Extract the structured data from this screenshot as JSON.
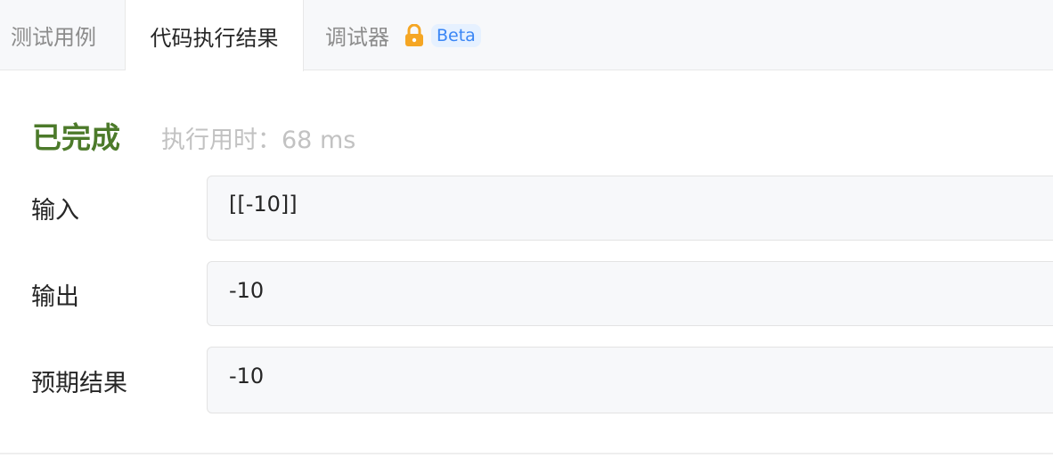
{
  "tabs": [
    {
      "label": "测试用例",
      "active": false
    },
    {
      "label": "代码执行结果",
      "active": true
    },
    {
      "label": "调试器",
      "active": false,
      "locked": true,
      "badge": "Beta"
    }
  ],
  "result": {
    "status": "已完成",
    "runtime": "执行用时：68 ms",
    "status_color": "#4c7a2a"
  },
  "rows": [
    {
      "label": "输入",
      "value": "[[-10]]"
    },
    {
      "label": "输出",
      "value": "-10"
    },
    {
      "label": "预期结果",
      "value": "-10"
    }
  ],
  "colors": {
    "accent_badge": "#3a86f5",
    "lock": "#f5a623"
  }
}
